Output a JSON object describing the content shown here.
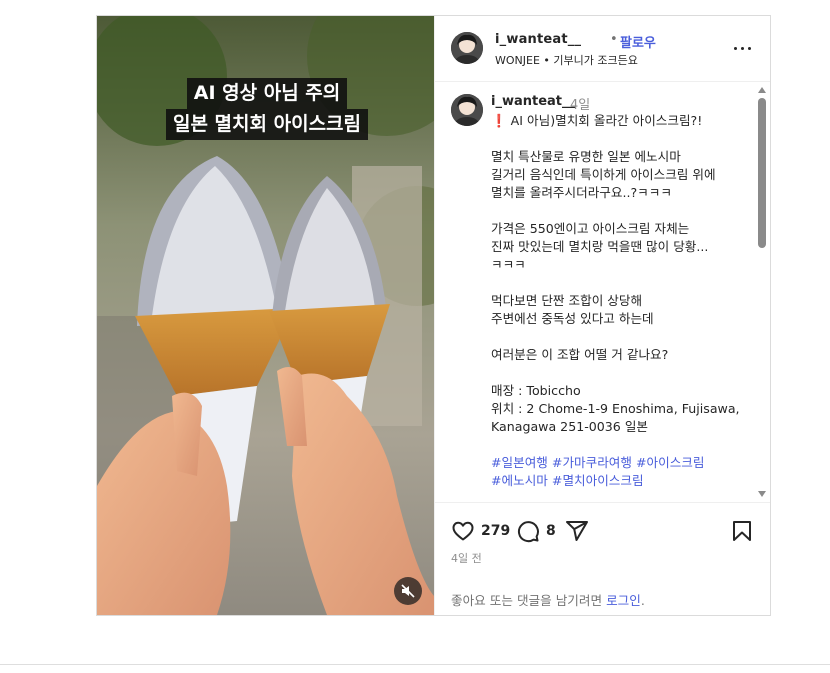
{
  "media": {
    "overlay_title_line1": "AI 영상 아님 주의",
    "overlay_title_line2": "일본 멸치회 아이스크림",
    "mute_icon": "speaker-muted-icon"
  },
  "header": {
    "username": "i_wanteat__",
    "separator": "•",
    "follow_label": "팔로우",
    "subtitle": "WONJEE • 기부니가 조크든요",
    "more_icon": "more-horizontal-icon"
  },
  "caption": {
    "username": "i_wanteat__",
    "time": "4일",
    "lines": [
      "❗ AI 아님)멸치회 올라간 아이스크림?!",
      "",
      "멸치 특산물로 유명한 일본 에노시마",
      "길거리 음식인데 특이하게 아이스크림 위에",
      "멸치를 올려주시더라구요..?ㅋㅋㅋ",
      "",
      "가격은 550엔이고 아이스크림 자체는",
      "진짜 맛있는데 멸치랑 먹을땐 많이 당황...",
      "ㅋㅋㅋ",
      "",
      "먹다보면 단짠 조합이 상당해",
      "주변에선 중독성 있다고 하는데",
      "",
      "여러분은 이 조합 어떨 거 같나요?",
      "",
      "매장 : Tobiccho",
      "위치 : 2 Chome-1-9 Enoshima, Fujisawa,",
      "Kanagawa 251-0036 일본",
      ""
    ],
    "hashtags_line1": "#일본여행 #가마쿠라여행 #아이스크림",
    "hashtags_line2": "#에노시마 #멸치아이스크림"
  },
  "actions": {
    "like_count": "279",
    "comment_count": "8",
    "posted": "4일 전",
    "login_prefix": "좋아요 또는 댓글을 남기려면 ",
    "login_link": "로그인",
    "login_suffix": "."
  }
}
